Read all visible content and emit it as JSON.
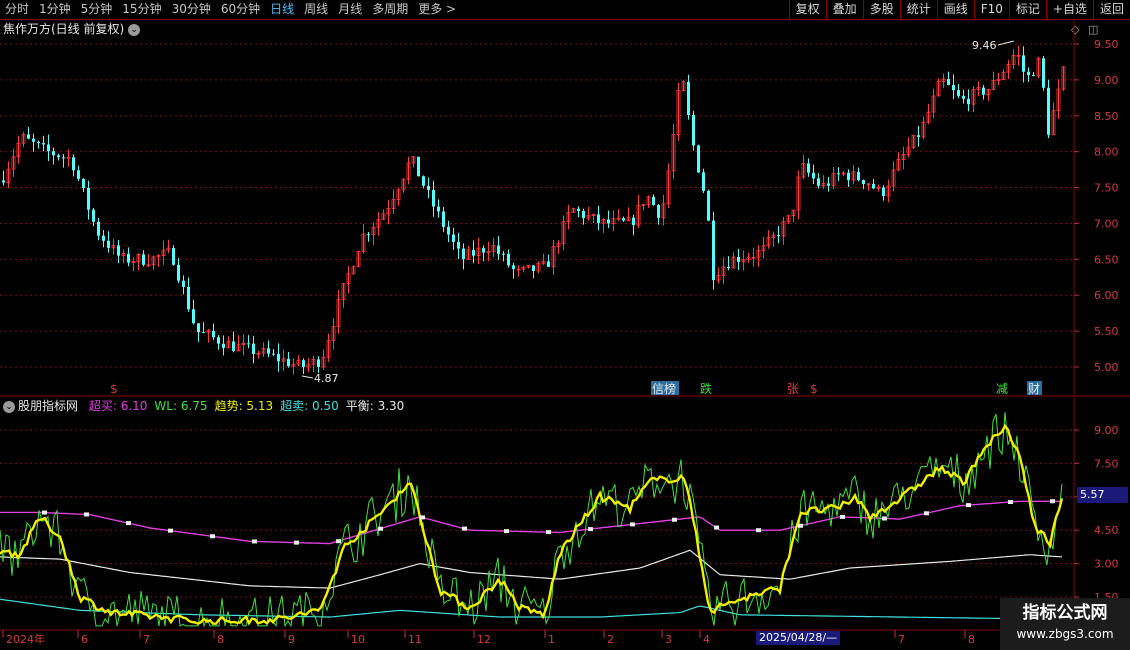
{
  "toolbar": {
    "periods": [
      "分时",
      "1分钟",
      "5分钟",
      "15分钟",
      "30分钟",
      "60分钟",
      "日线",
      "周线",
      "月线",
      "多周期",
      "更多 >"
    ],
    "active_period": "日线",
    "tools": [
      "复权",
      "叠加",
      "多股",
      "统计",
      "画线",
      "F10",
      "标记",
      "+自选",
      "返回"
    ]
  },
  "stock": {
    "title": "焦作万方(日线 前复权)"
  },
  "indicator": {
    "name": "股朋指标网",
    "items": [
      {
        "label": "超买: 6.10",
        "color": "#e040e0"
      },
      {
        "label": "WL: 6.75",
        "color": "#40e040"
      },
      {
        "label": "趋势: 5.13",
        "color": "#f0f000"
      },
      {
        "label": "超卖: 0.50",
        "color": "#40e0e0"
      },
      {
        "label": "平衡: 3.30",
        "color": "#e8e8e8"
      }
    ]
  },
  "price_axis": [
    "9.50",
    "9.00",
    "8.50",
    "8.00",
    "7.50",
    "7.00",
    "6.50",
    "6.00",
    "5.50",
    "5.00"
  ],
  "indicator_axis": [
    "9.00",
    "7.50",
    "6.00",
    "4.50",
    "3.00",
    "1.50"
  ],
  "annotations": {
    "high": "9.46",
    "low": "4.87",
    "last_value": "5.57"
  },
  "event_tags": [
    {
      "text": "$",
      "color": "#e03030"
    },
    {
      "text": "信榜",
      "color": "#e8e8e8",
      "bg": "#2a6ea0"
    },
    {
      "text": "跌",
      "color": "#40e040"
    },
    {
      "text": "张",
      "color": "#e04040"
    },
    {
      "text": "$",
      "color": "#e03030"
    },
    {
      "text": "减",
      "color": "#40e040"
    },
    {
      "text": "财",
      "color": "#e8e8e8",
      "bg": "#2a6ea0"
    }
  ],
  "time_axis": [
    "2024年",
    "6",
    "7",
    "8",
    "9",
    "10",
    "11",
    "12",
    "1",
    "2",
    "3",
    "4",
    "7",
    "8"
  ],
  "time_cursor": "2025/04/28/—",
  "watermark": {
    "title": "指标公式网",
    "url": "www.zbgs3.com"
  },
  "colors": {
    "up": "#ff3c3c",
    "down": "#54ffff",
    "grid": "#7a1010",
    "chaomai": "#e040e0",
    "wl": "#40e040",
    "trend": "#f0f000",
    "chaomai_low": "#40e0e0",
    "balance": "#e8e8e8"
  }
}
